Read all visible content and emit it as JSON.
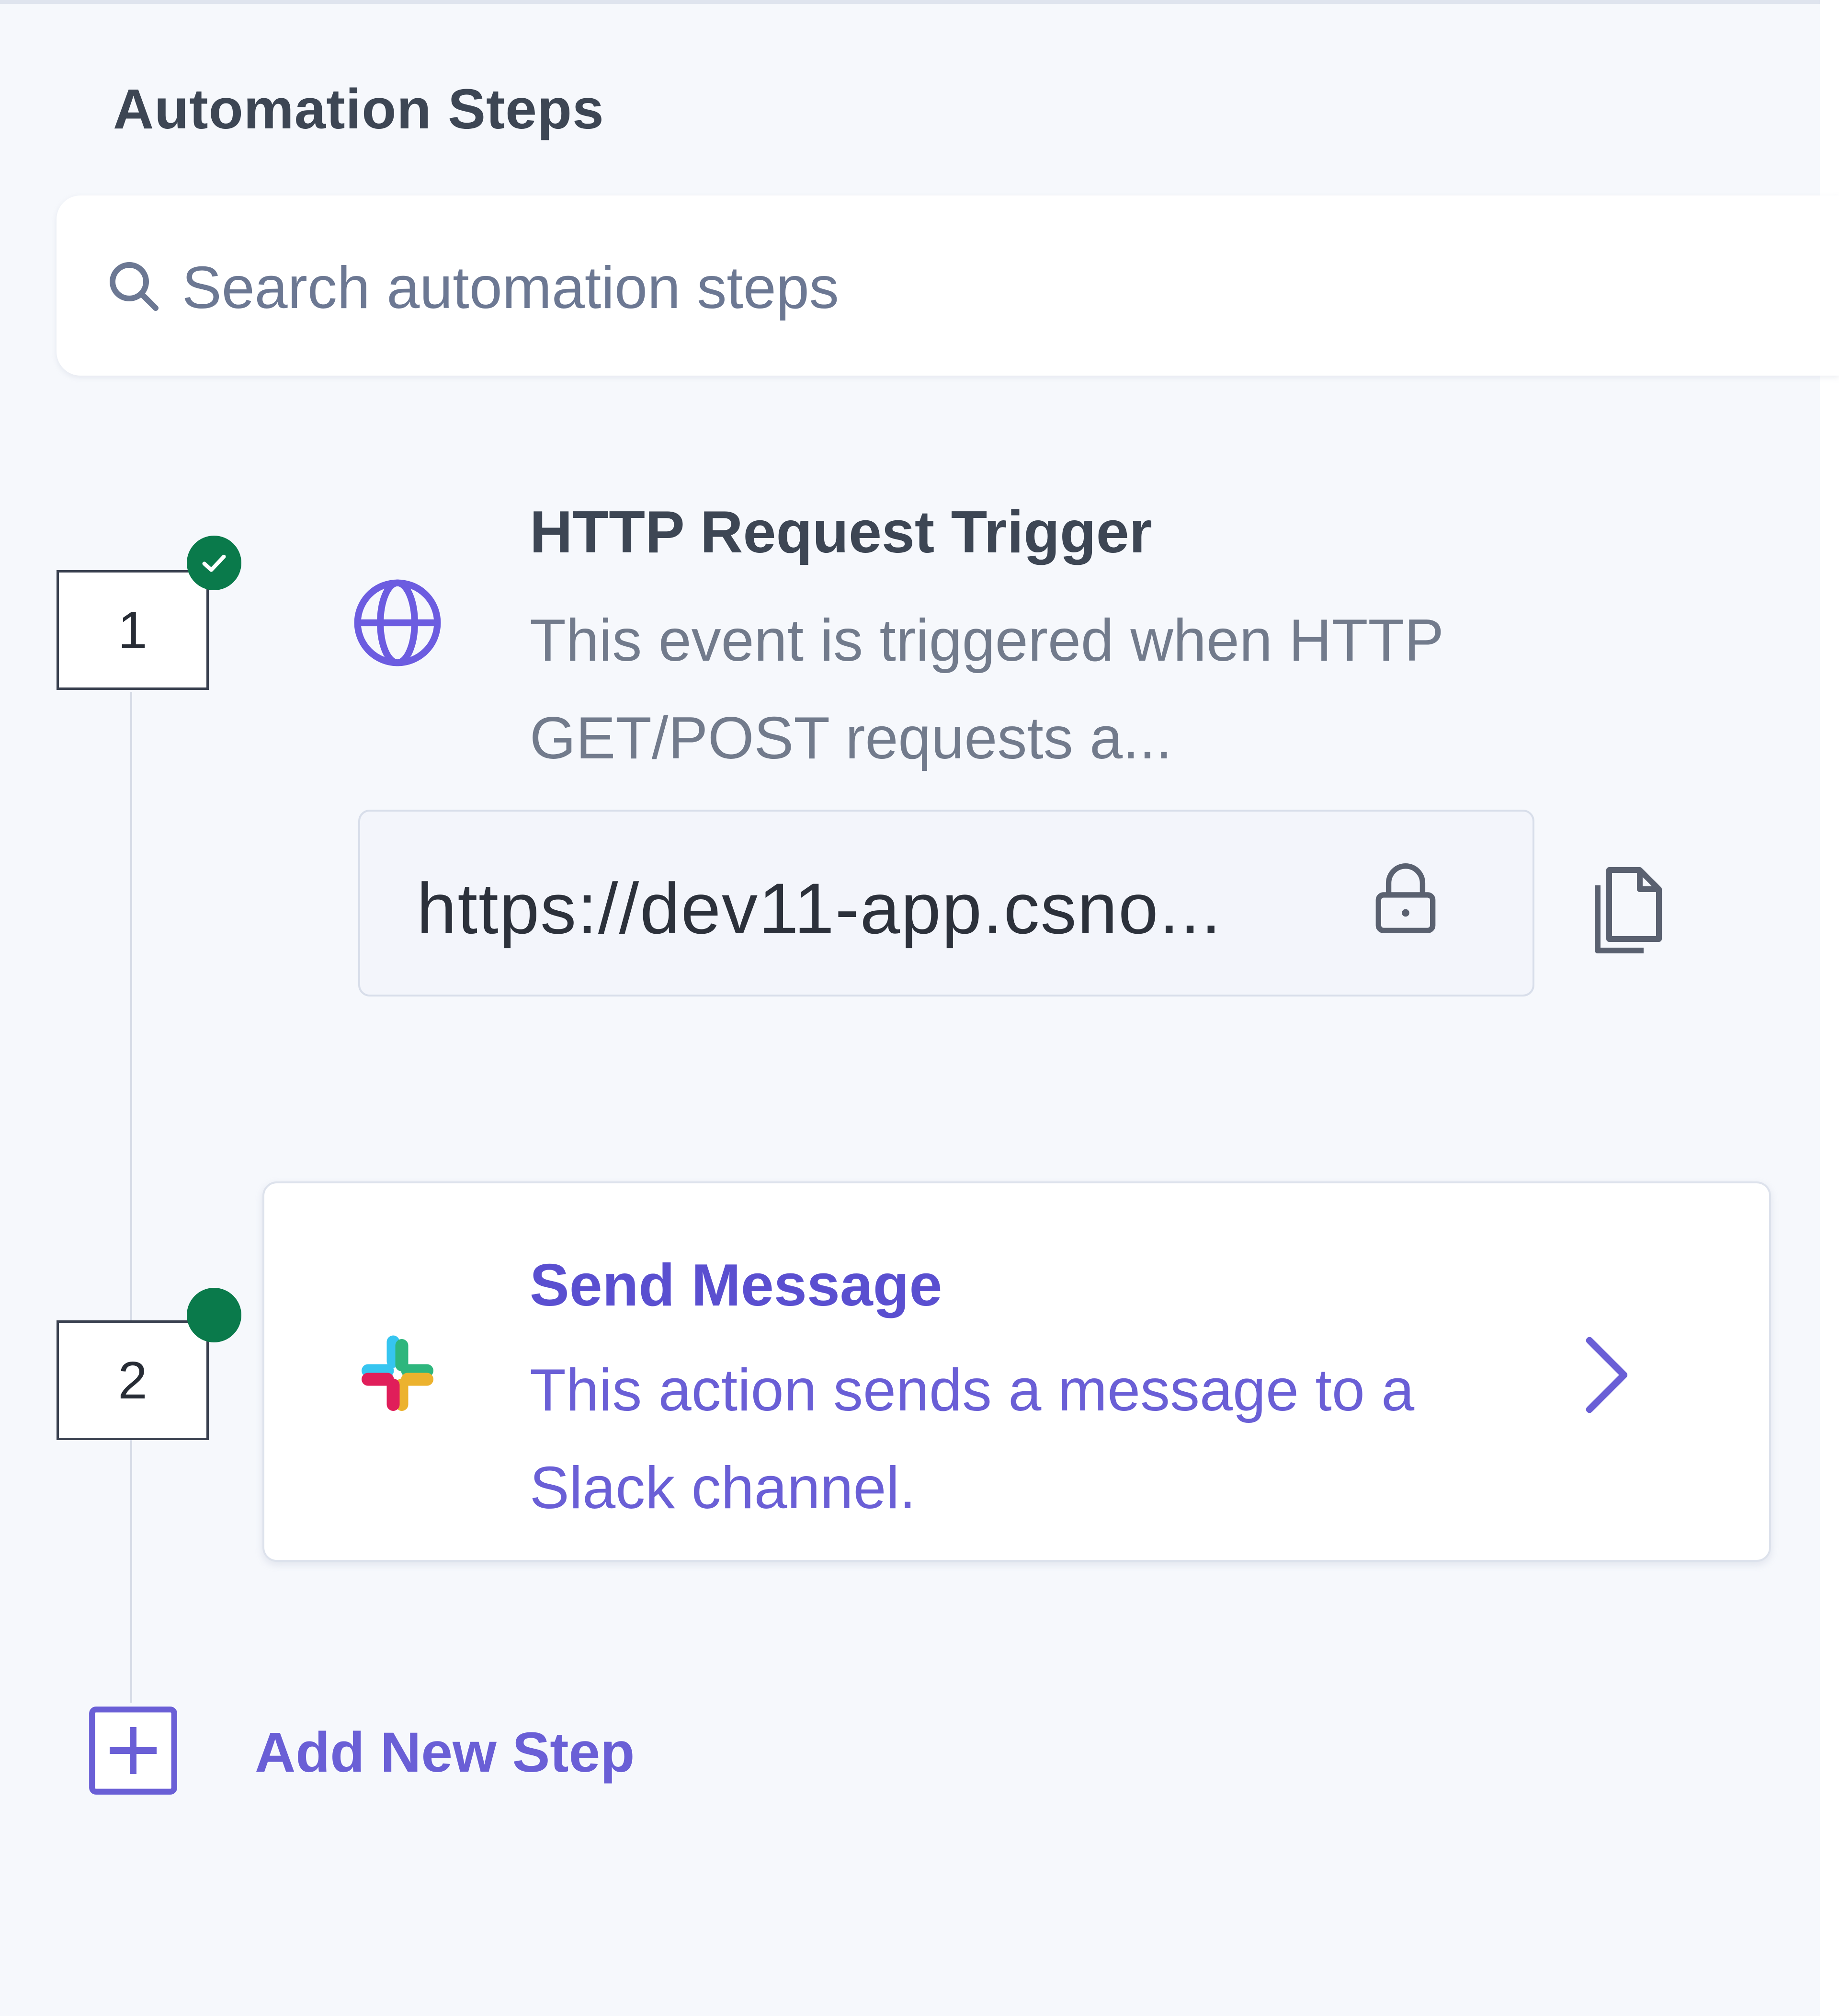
{
  "panel": {
    "title": "Automation Steps"
  },
  "search": {
    "placeholder": "Search automation steps",
    "icon": "search-icon"
  },
  "steps": [
    {
      "number": "1",
      "status": "completed",
      "icon": "globe-icon",
      "title": "HTTP Request Trigger",
      "description": "This event is triggered when HTTP GET/POST requests a...",
      "url": "https://dev11-app.csno...",
      "url_icons": [
        "lock-icon",
        "copy-icon"
      ]
    },
    {
      "number": "2",
      "status": "active",
      "icon": "slack-icon",
      "title": "Send Message",
      "description": "This action sends a message to a Slack channel.",
      "action_icon": "chevron-right-icon"
    }
  ],
  "add_step": {
    "label": "Add New Step",
    "icon": "plus-icon"
  },
  "colors": {
    "accent": "#5a4fd0",
    "status_green": "#0a7a4b",
    "background": "#f6f8fc"
  }
}
